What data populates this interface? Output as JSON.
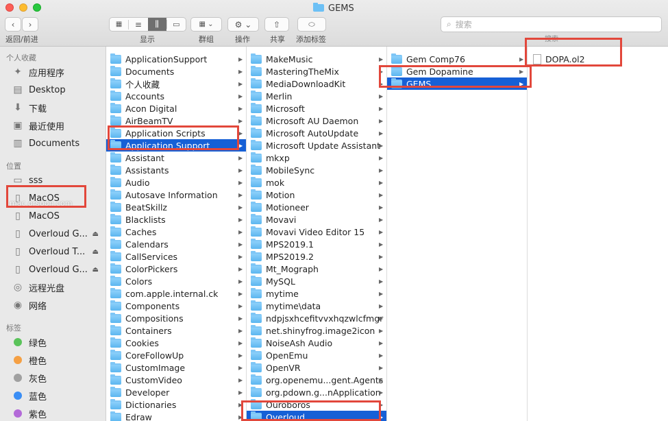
{
  "window": {
    "title": "GEMS"
  },
  "toolbar": {
    "back_forward_label": "返回/前进",
    "view_label": "显示",
    "group_label": "群组",
    "action_label": "操作",
    "share_label": "共享",
    "tags_label": "添加标签",
    "search_placeholder": "搜索",
    "search_scope_label": "搜索"
  },
  "sidebar": {
    "favorites_header": "个人收藏",
    "favorites": [
      {
        "label": "应用程序",
        "icon": "applications-icon"
      },
      {
        "label": "Desktop",
        "icon": "desktop-icon"
      },
      {
        "label": "下载",
        "icon": "downloads-icon"
      },
      {
        "label": "最近使用",
        "icon": "recents-icon"
      },
      {
        "label": "Documents",
        "icon": "documents-icon"
      }
    ],
    "locations_header": "位置",
    "locations": [
      {
        "label": "sss",
        "icon": "computer-icon"
      },
      {
        "label": "MacOS",
        "icon": "disk-icon"
      },
      {
        "label": "MacOS",
        "icon": "disk-icon"
      },
      {
        "label": "Overloud G...",
        "icon": "disk-icon"
      },
      {
        "label": "Overloud T...",
        "icon": "disk-icon"
      },
      {
        "label": "Overloud G...",
        "icon": "disk-icon"
      },
      {
        "label": "远程光盘",
        "icon": "optical-disc-icon"
      },
      {
        "label": "网络",
        "icon": "network-icon"
      }
    ],
    "tags_header": "标签",
    "tags": [
      {
        "label": "绿色",
        "color": "#5ac35a"
      },
      {
        "label": "橙色",
        "color": "#f5a044"
      },
      {
        "label": "灰色",
        "color": "#a0a0a0"
      },
      {
        "label": "蓝色",
        "color": "#3a8ef5"
      },
      {
        "label": "紫色",
        "color": "#b36ad8"
      }
    ]
  },
  "columns": [
    {
      "items": [
        "ApplicationSupport",
        "Documents",
        "个人收藏",
        "Accounts",
        "Acon Digital",
        "AirBeamTV",
        "Application Scripts",
        "Application Support",
        "Assistant",
        "Assistants",
        "Audio",
        "Autosave Information",
        "BeatSkillz",
        "Blacklists",
        "Caches",
        "Calendars",
        "CallServices",
        "ColorPickers",
        "Colors",
        "com.apple.internal.ck",
        "Components",
        "Compositions",
        "Containers",
        "Cookies",
        "CoreFollowUp",
        "CustomImage",
        "CustomVideo",
        "Developer",
        "Dictionaries",
        "Edraw"
      ],
      "selected": "Application Support"
    },
    {
      "items": [
        "MakeMusic",
        "MasteringTheMix",
        "MediaDownloadKit",
        "Merlin",
        "Microsoft",
        "Microsoft AU Daemon",
        "Microsoft AutoUpdate",
        "Microsoft Update Assistant",
        "mkxp",
        "MobileSync",
        "mok",
        "Motion",
        "Motioneer",
        "Movavi",
        "Movavi Video Editor 15",
        "MPS2019.1",
        "MPS2019.2",
        "Mt_Mograph",
        "MySQL",
        "mytime",
        "mytime\\data",
        "ndpjsxhcefitvvxhqzwlcfmgr",
        "net.shinyfrog.image2icon",
        "NoiseAsh Audio",
        "OpenEmu",
        "OpenVR",
        "org.openemu...gent.Agents",
        "org.pdown.g...nApplication",
        "Ouroboros",
        "Overloud"
      ],
      "selected": "Overloud"
    },
    {
      "items": [
        "Gem Comp76",
        "Gem Dopamine",
        "GEMS"
      ],
      "selected": "GEMS"
    },
    {
      "items": [
        "DOPA.ol2"
      ],
      "selected": ""
    }
  ],
  "watermark": "mac.orsoon.com",
  "accent_color": "#1660d6",
  "highlight_color": "#e2473b"
}
